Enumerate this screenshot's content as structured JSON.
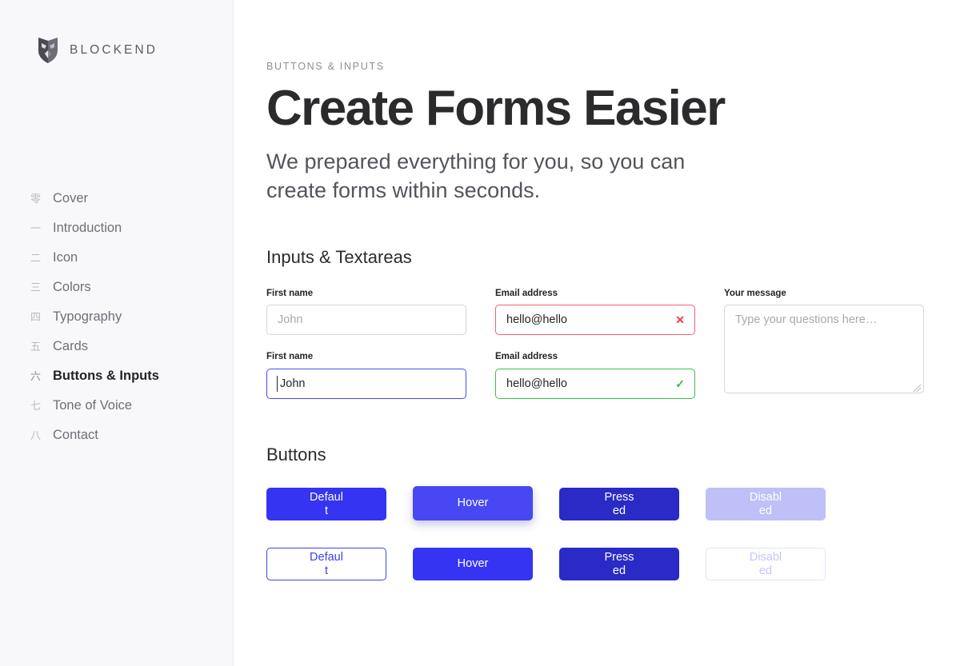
{
  "brand": {
    "name": "BLOCKEND",
    "logo_icon": "fox-head-logo-icon"
  },
  "sidebar": {
    "items": [
      {
        "num": "零",
        "label": "Cover",
        "active": false
      },
      {
        "num": "一",
        "label": "Introduction",
        "active": false
      },
      {
        "num": "二",
        "label": "Icon",
        "active": false
      },
      {
        "num": "三",
        "label": "Colors",
        "active": false
      },
      {
        "num": "四",
        "label": "Typography",
        "active": false
      },
      {
        "num": "五",
        "label": "Cards",
        "active": false
      },
      {
        "num": "六",
        "label": "Buttons & Inputs",
        "active": true
      },
      {
        "num": "七",
        "label": "Tone of Voice",
        "active": false
      },
      {
        "num": "八",
        "label": "Contact",
        "active": false
      }
    ]
  },
  "header": {
    "eyebrow": "BUTTONS & INPUTS",
    "title": "Create Forms Easier",
    "subtitle": "We prepared everything for you, so you can create forms within seconds."
  },
  "sections": {
    "inputs_title": "Inputs & Textareas",
    "buttons_title": "Buttons"
  },
  "fields": {
    "first_name_placeholder_label": "First name",
    "first_name_placeholder_value": "",
    "first_name_placeholder": "John",
    "email_error_label": "Email address",
    "email_error_value": "hello@hello",
    "email_error_icon": "✕",
    "message_label": "Your message",
    "message_value": "",
    "message_placeholder": "Type your questions here…",
    "first_name_focus_label": "First name",
    "first_name_focus_value": "John",
    "email_success_label": "Email address",
    "email_success_value": "hello@hello",
    "email_success_icon": "✓"
  },
  "buttons": {
    "solid": [
      {
        "label": "Default",
        "state": "default"
      },
      {
        "label": "Hover",
        "state": "hover"
      },
      {
        "label": "Pressed",
        "state": "pressed"
      },
      {
        "label": "Disabled",
        "state": "disabled"
      }
    ],
    "outline": [
      {
        "label": "Default",
        "state": "default"
      },
      {
        "label": "Hover",
        "state": "hover"
      },
      {
        "label": "Pressed",
        "state": "pressed"
      },
      {
        "label": "Disabled",
        "state": "disabled"
      }
    ]
  },
  "colors": {
    "primary": "#3434f2",
    "primary_hover": "#4848f2",
    "primary_pressed": "#2a2ac6",
    "primary_disabled": "#bfc0f7",
    "error": "#f4626c",
    "success": "#3bc04b",
    "focus": "#4b4bee",
    "sidebar_bg": "#f8f8fa",
    "text_dark": "#2b2b2e",
    "text_muted": "#6e6e78"
  }
}
